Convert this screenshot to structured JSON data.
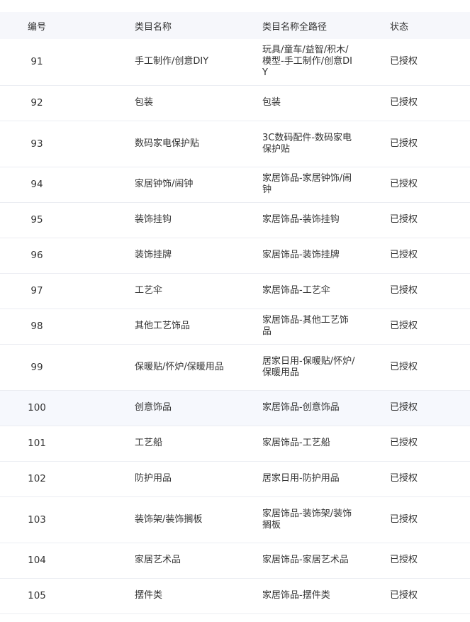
{
  "table": {
    "headers": {
      "id": "编号",
      "name": "类目名称",
      "path": "类目名称全路径",
      "status": "状态"
    },
    "rows": [
      {
        "id": "91",
        "name": "手工制作/创意DIY",
        "path": "玩具/童车/益智/积木/模型-手工制作/创意DIY",
        "status": "已授权"
      },
      {
        "id": "92",
        "name": "包装",
        "path": "包装",
        "status": "已授权"
      },
      {
        "id": "93",
        "name": "数码家电保护贴",
        "path": "3C数码配件-数码家电保护贴",
        "status": "已授权"
      },
      {
        "id": "94",
        "name": "家居钟饰/闹钟",
        "path": "家居饰品-家居钟饰/闹钟",
        "status": "已授权"
      },
      {
        "id": "95",
        "name": "装饰挂钩",
        "path": "家居饰品-装饰挂钩",
        "status": "已授权"
      },
      {
        "id": "96",
        "name": "装饰挂牌",
        "path": "家居饰品-装饰挂牌",
        "status": "已授权"
      },
      {
        "id": "97",
        "name": "工艺伞",
        "path": "家居饰品-工艺伞",
        "status": "已授权"
      },
      {
        "id": "98",
        "name": "其他工艺饰品",
        "path": "家居饰品-其他工艺饰品",
        "status": "已授权"
      },
      {
        "id": "99",
        "name": "保暖贴/怀炉/保暖用品",
        "path": "居家日用-保暖贴/怀炉/保暖用品",
        "status": "已授权"
      },
      {
        "id": "100",
        "name": "创意饰品",
        "path": "家居饰品-创意饰品",
        "status": "已授权"
      },
      {
        "id": "101",
        "name": "工艺船",
        "path": "家居饰品-工艺船",
        "status": "已授权"
      },
      {
        "id": "102",
        "name": "防护用品",
        "path": "居家日用-防护用品",
        "status": "已授权"
      },
      {
        "id": "103",
        "name": "装饰架/装饰搁板",
        "path": "家居饰品-装饰架/装饰搁板",
        "status": "已授权"
      },
      {
        "id": "104",
        "name": "家居艺术品",
        "path": "家居饰品-家居艺术品",
        "status": "已授权"
      },
      {
        "id": "105",
        "name": "摆件类",
        "path": "家居饰品-摆件类",
        "status": "已授权"
      }
    ]
  }
}
